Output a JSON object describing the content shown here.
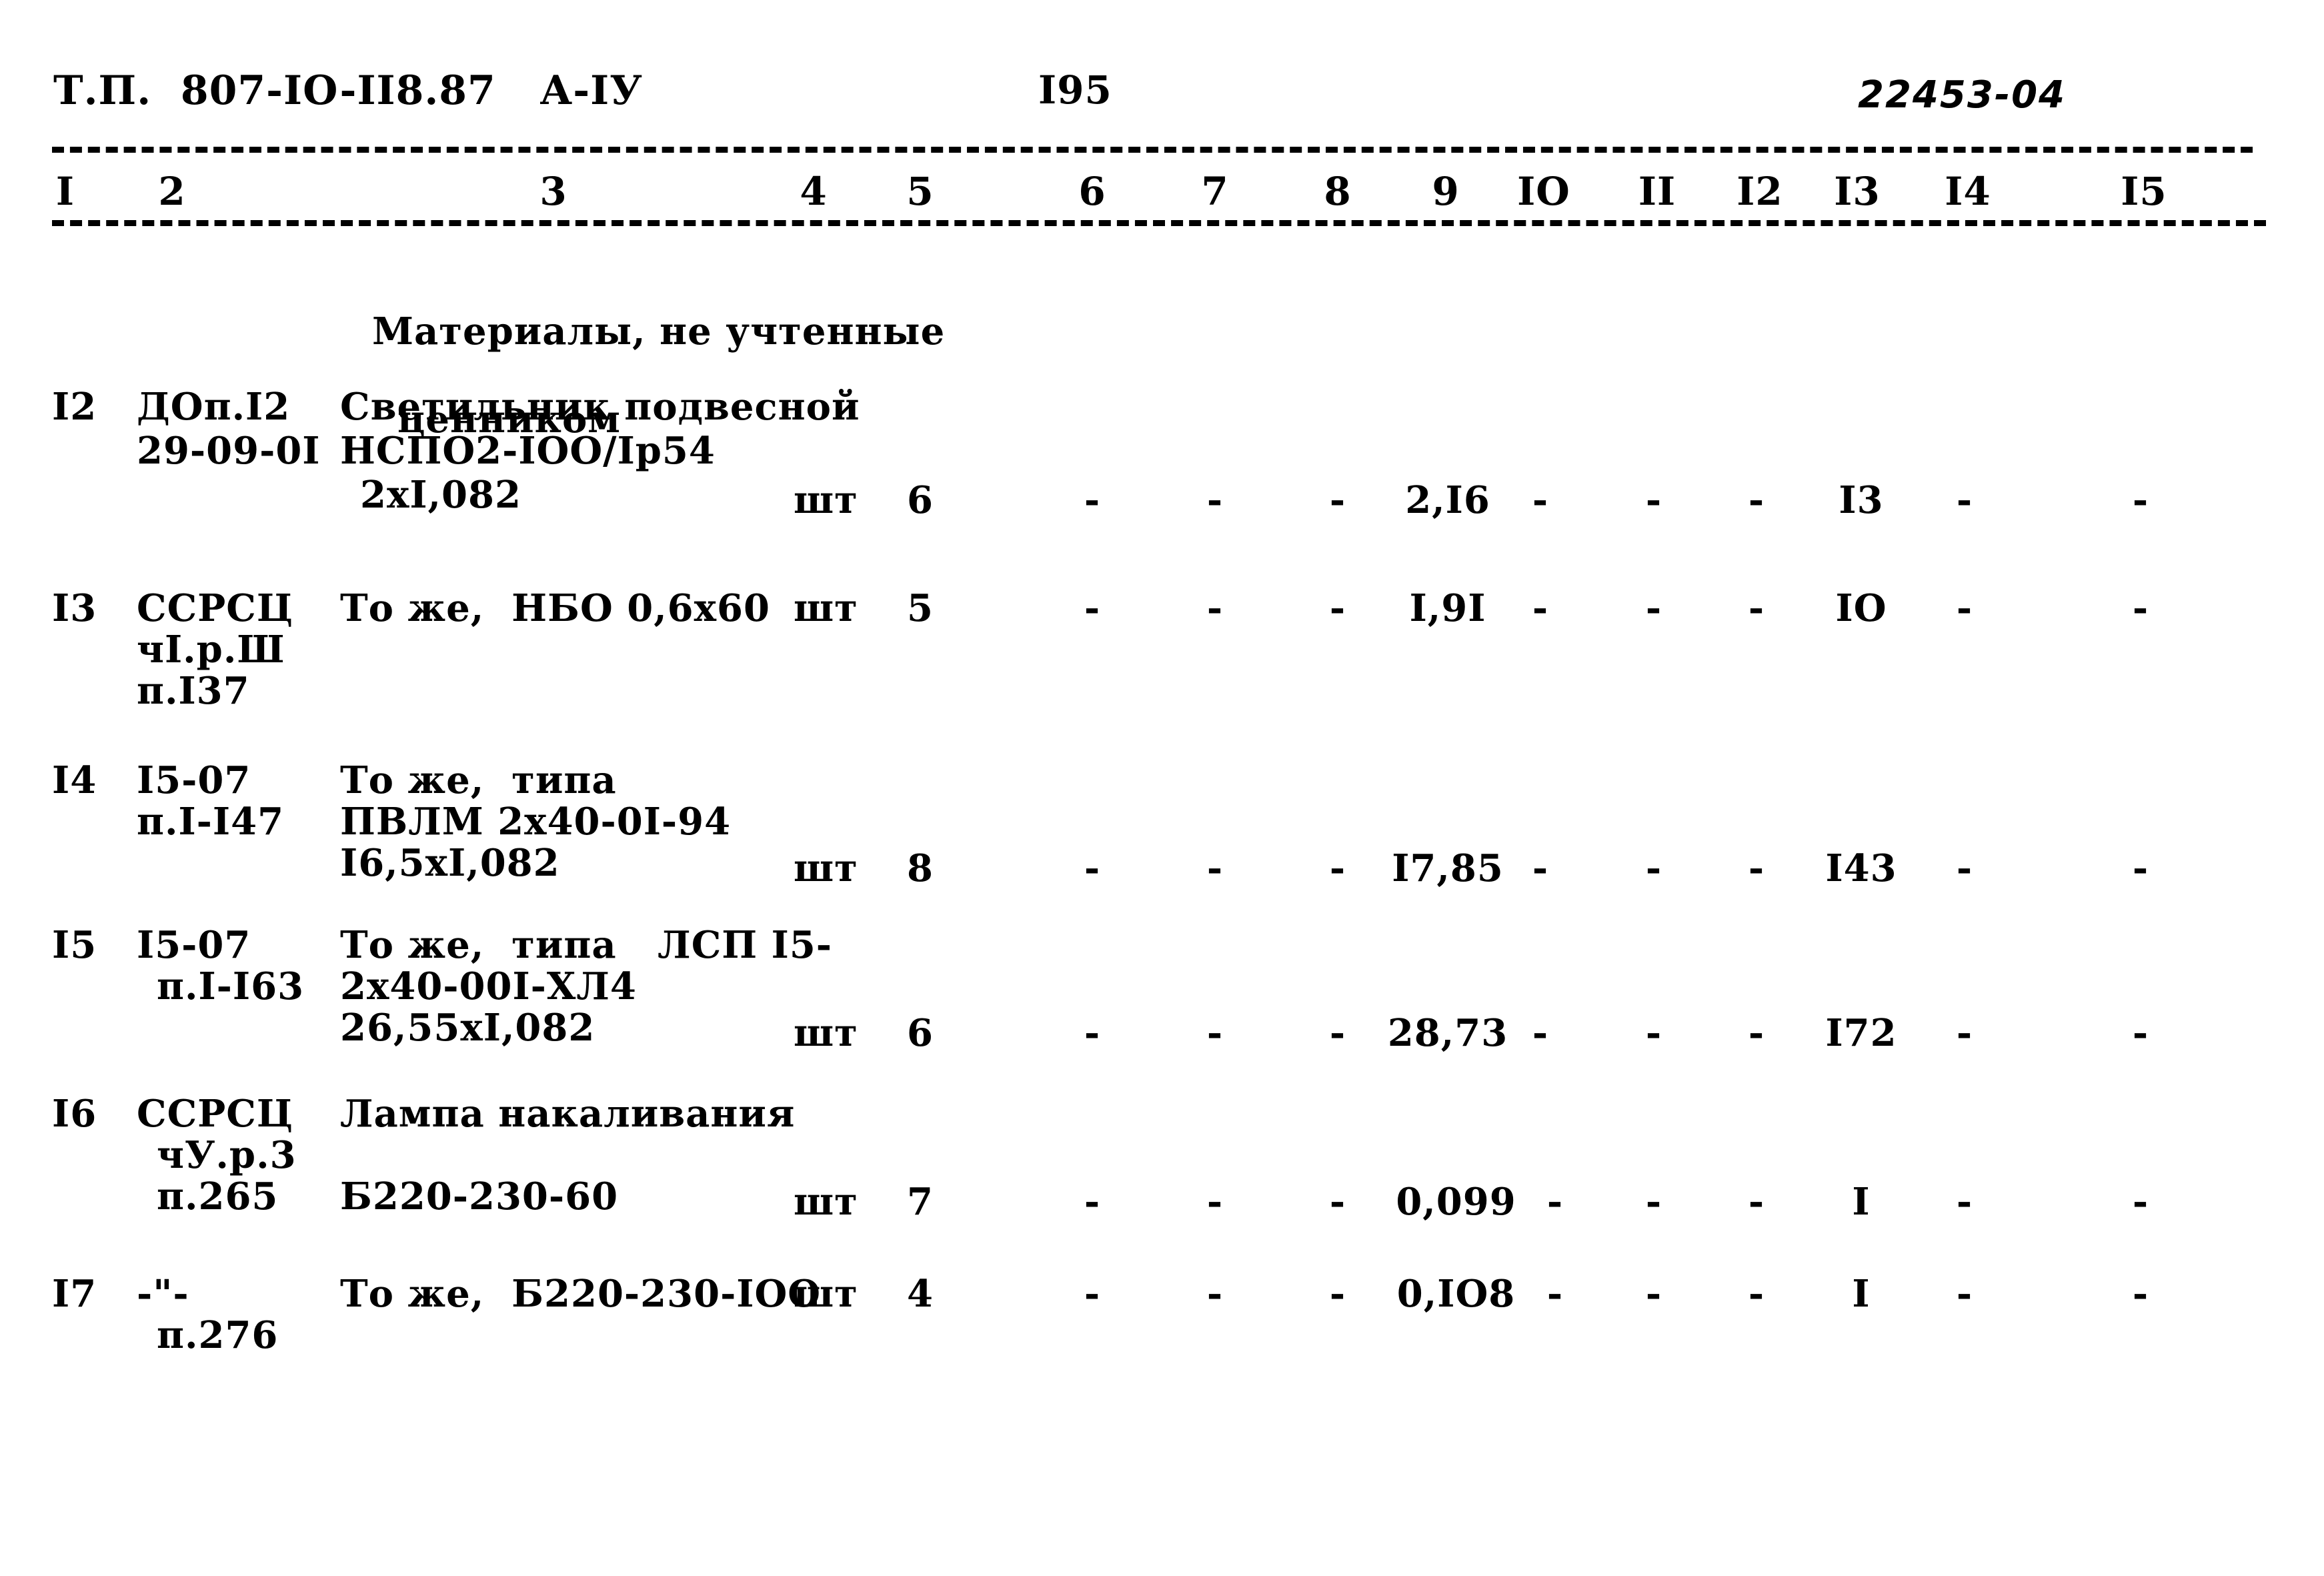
{
  "header": {
    "doc_code": "Т.П.  807-IO-II8.87   А-IУ",
    "page_number": "I95",
    "sheet_code": "22453-04"
  },
  "table": {
    "column_numbers": [
      "I",
      "2",
      "3",
      "4",
      "5",
      "6",
      "7",
      "8",
      "9",
      "IO",
      "II",
      "I2",
      "I3",
      "I4",
      "I5"
    ],
    "section_caption_line1": "Материалы, не учтенные",
    "section_caption_line2": "ценником",
    "dash_glyph": "-",
    "rows": [
      {
        "no": "I2",
        "code_lines": [
          "ДОп.I2",
          "29-09-0I"
        ],
        "name_lines": [
          "Светильник подвесной",
          "НСПО2-IОО/Iр54",
          "2хI,082"
        ],
        "unit": "шт",
        "qty": "6",
        "col6": "-",
        "col7": "-",
        "col8": "-",
        "col9": "2,I6",
        "col10": "-",
        "col11": "-",
        "col12": "-",
        "col13": "I3",
        "col14": "-",
        "col15": "-"
      },
      {
        "no": "I3",
        "code_lines": [
          "ССРСЦ",
          "чI.р.Ш",
          "п.I37"
        ],
        "name_lines": [
          "То же,  НБО 0,6х60"
        ],
        "unit": "шт",
        "qty": "5",
        "col6": "-",
        "col7": "-",
        "col8": "-",
        "col9": "I,9I",
        "col10": "-",
        "col11": "-",
        "col12": "-",
        "col13": "IO",
        "col14": "-",
        "col15": "-"
      },
      {
        "no": "I4",
        "code_lines": [
          "I5-07",
          "п.I-I47"
        ],
        "name_lines": [
          "То же,  типа",
          "ПВЛМ 2х40-0I-94",
          "I6,5хI,082"
        ],
        "unit": "шт",
        "qty": "8",
        "col6": "-",
        "col7": "-",
        "col8": "-",
        "col9": "I7,85",
        "col10": "-",
        "col11": "-",
        "col12": "-",
        "col13": "I43",
        "col14": "-",
        "col15": "-"
      },
      {
        "no": "I5",
        "code_lines": [
          "I5-07",
          "п.I-I63"
        ],
        "name_lines": [
          "То же,  типа   ЛСП I5-",
          "2х40-00I-ХЛ4",
          "26,55хI,082"
        ],
        "unit": "шт",
        "qty": "6",
        "col6": "-",
        "col7": "-",
        "col8": "-",
        "col9": "28,73",
        "col10": "-",
        "col11": "-",
        "col12": "-",
        "col13": "I72",
        "col14": "-",
        "col15": "-"
      },
      {
        "no": "I6",
        "code_lines": [
          "ССРСЦ",
          "чУ.р.3",
          "п.265"
        ],
        "name_lines": [
          "Лампа накаливания",
          "",
          "Б220-230-60"
        ],
        "unit": "шт",
        "qty": "7",
        "col6": "-",
        "col7": "-",
        "col8": "-",
        "col9": "0,099",
        "col10": "-",
        "col11": "-",
        "col12": "-",
        "col13": "I",
        "col14": "-",
        "col15": "-"
      },
      {
        "no": "I7",
        "code_lines": [
          "-\"-",
          "п.276"
        ],
        "name_lines": [
          "То же,  Б220-230-IОО"
        ],
        "unit": "шт",
        "qty": "4",
        "col6": "-",
        "col7": "-",
        "col8": "-",
        "col9": "0,IО8",
        "col10": "-",
        "col11": "-",
        "col12": "-",
        "col13": "I",
        "col14": "-",
        "col15": "-"
      }
    ]
  }
}
